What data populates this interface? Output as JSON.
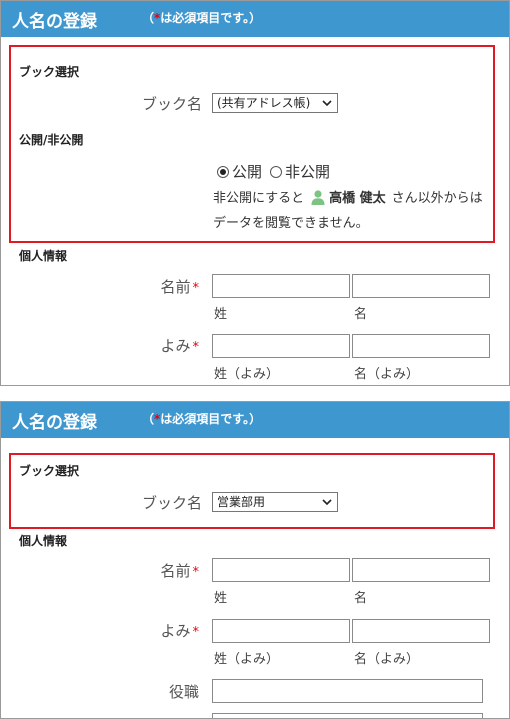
{
  "panel1": {
    "title": "人名の登録",
    "required_note": {
      "prefix": "（",
      "mark": "*",
      "text": "は必須項目です。）"
    },
    "book_section_label": "ブック選択",
    "book_label": "ブック名",
    "book_select_value": "(共有アドレス帳)",
    "visibility_section_label": "公開/非公開",
    "radio_public": "公開",
    "radio_private": "非公開",
    "private_note_before": "非公開にすると",
    "private_note_user": "高橋 健太",
    "private_note_after": "さん以外からは",
    "private_note_line2": "データを閲覧できません。",
    "personal_section_label": "個人情報",
    "name_label": "名前",
    "name_req_mark": "*",
    "sub_last": "姓",
    "sub_first": "名",
    "yomi_label": "よみ",
    "yomi_req_mark": "*",
    "sub_yomi_last": "姓（よみ）",
    "sub_yomi_first": "名（よみ）"
  },
  "panel2": {
    "title": "人名の登録",
    "required_note": {
      "prefix": "（",
      "mark": "*",
      "text": "は必須項目です。）"
    },
    "book_section_label": "ブック選択",
    "book_label": "ブック名",
    "book_select_value": "営業部用",
    "personal_section_label": "個人情報",
    "name_label": "名前",
    "name_req_mark": "*",
    "sub_last": "姓",
    "sub_first": "名",
    "yomi_label": "よみ",
    "yomi_req_mark": "*",
    "sub_yomi_last": "姓（よみ）",
    "sub_yomi_first": "名（よみ）",
    "title_field_label": "役職"
  },
  "colors": {
    "header_bg": "#3f97d0",
    "highlight_border": "#e01a22",
    "required": "#e60012"
  },
  "icons": {
    "select_arrow": "chevron-down-icon",
    "user": "user-icon"
  }
}
